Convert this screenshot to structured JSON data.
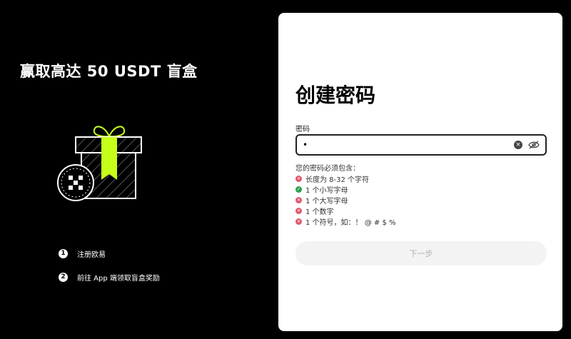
{
  "promo": {
    "title": "赢取高达 50 USDT 盲盒",
    "steps": [
      {
        "num": "1",
        "text": "注册欧易"
      },
      {
        "num": "2",
        "text": "前往 App 端领取盲盒奖励"
      }
    ]
  },
  "form": {
    "title": "创建密码",
    "password_label": "密码",
    "password_value": "•",
    "requirements_title": "您的密码必须包含：",
    "requirements": [
      {
        "text": "长度为 8-32 个字符",
        "met": false
      },
      {
        "text": "1 个小写字母",
        "met": true
      },
      {
        "text": "1 个大写字母",
        "met": false
      },
      {
        "text": "1 个数字",
        "met": false
      },
      {
        "text": "1 个符号，如：！ @ # $ %",
        "met": false
      }
    ],
    "next_label": "下一步"
  },
  "colors": {
    "accent": "#c6ff1a",
    "fail": "#e0556b",
    "pass": "#2aa14b"
  },
  "icons": {
    "clear": "clear-icon",
    "visibility": "eye-off-icon",
    "illustration": "gift-box-icon",
    "logo": "okx-logo-icon"
  }
}
